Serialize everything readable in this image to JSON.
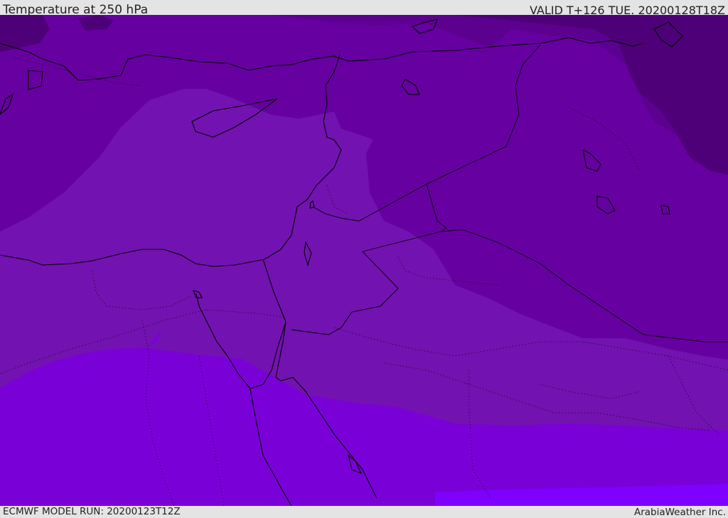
{
  "header": {
    "title": "Temperature at 250 hPa",
    "valid": "VALID T+126 TUE. 20200128T18Z"
  },
  "footer": {
    "model_run": "ECMWF MODEL RUN: 20200123T12Z",
    "credit": "ArabiaWeather Inc."
  },
  "colors": {
    "band_darkest": "#4e0078",
    "band_dark": "#5c0090",
    "band_mid": "#6600a0",
    "band_light": "#7212b0",
    "band_bright": "#7a00d8",
    "band_brightest": "#7e00ff",
    "coastline": "#000000"
  },
  "map": {
    "variable": "temperature",
    "pressure_level_hpa": 250
  }
}
